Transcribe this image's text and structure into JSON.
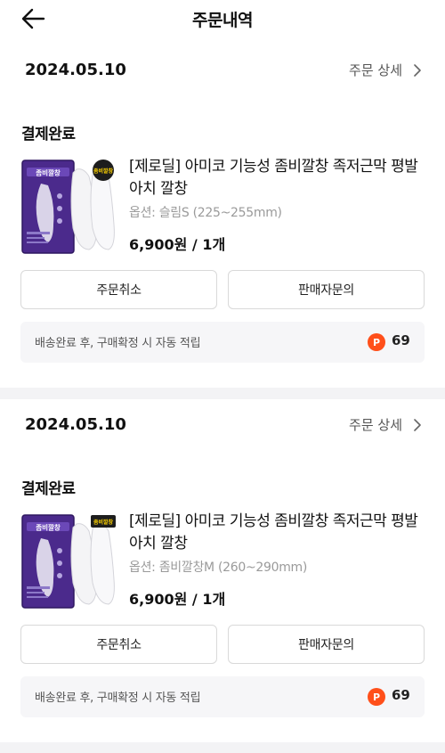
{
  "header": {
    "title": "주문내역"
  },
  "orders": [
    {
      "date": "2024.05.10",
      "detail_label": "주문 상세",
      "status": "결제완료",
      "product": {
        "name": "[제로딜] 아미코 기능성 좀비깔창 족저근막 평발 아치 깔창",
        "option": "옵션: 슬림S (225~255mm)",
        "price": "6,900원 / 1개",
        "thumb_logo": "좀비깔창",
        "thumb_badge": "좀비깔창"
      },
      "cancel_label": "주문취소",
      "inquiry_label": "판매자문의",
      "point_text": "배송완료 후, 구매확정 시 자동 적립",
      "point_badge": "P",
      "point_value": "69"
    },
    {
      "date": "2024.05.10",
      "detail_label": "주문 상세",
      "status": "결제완료",
      "product": {
        "name": "[제로딜] 아미코 기능성 좀비깔창 족저근막 평발 아치 깔창",
        "option": "옵션: 좀비깔창M (260~290mm)",
        "price": "6,900원 / 1개",
        "thumb_logo": "좀비깔창",
        "thumb_badge": "좀비깔창"
      },
      "cancel_label": "주문취소",
      "inquiry_label": "판매자문의",
      "point_text": "배송완료 후, 구매확정 시 자동 적립",
      "point_badge": "P",
      "point_value": "69"
    }
  ],
  "colors": {
    "point": "#ff4f1a",
    "box_purple": "#4b2a8c"
  },
  "icons": {
    "back": "arrow-left-icon",
    "detail": "chevron-right-icon"
  }
}
